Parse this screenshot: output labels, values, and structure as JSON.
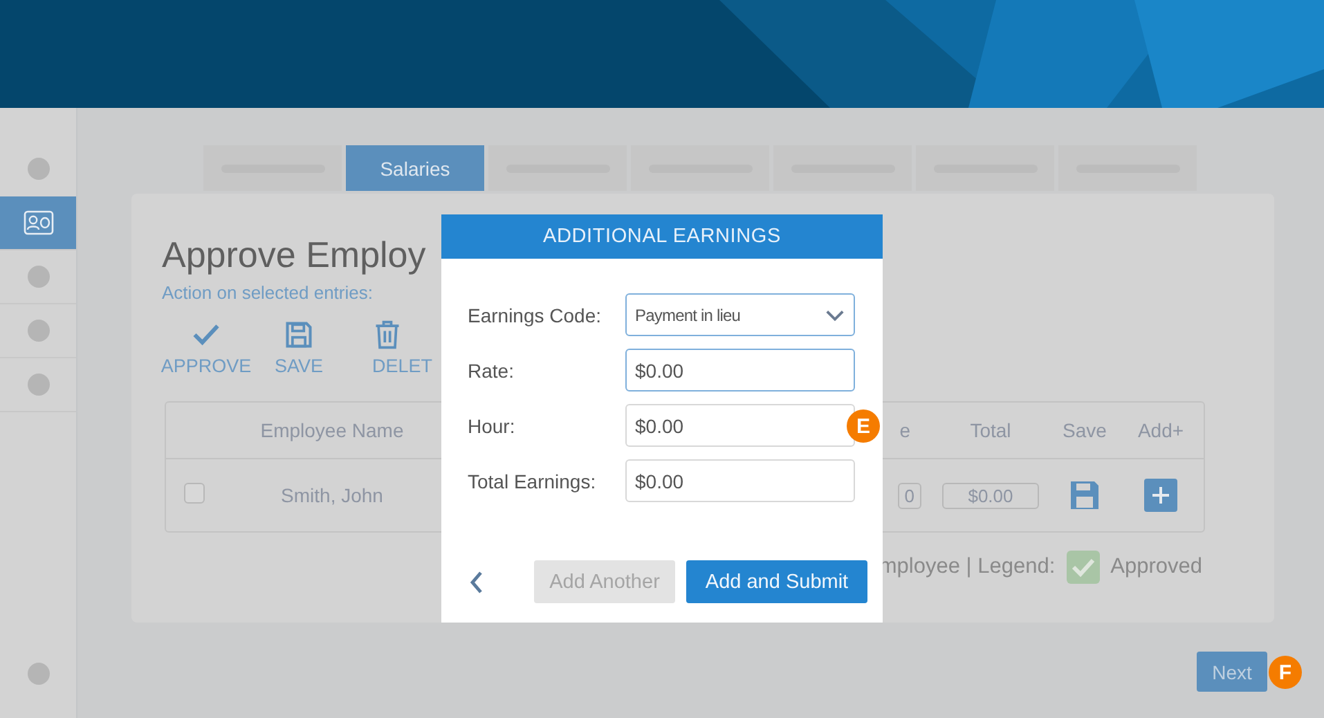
{
  "sidebar": {
    "items": [
      {
        "kind": "dot",
        "selected": false
      },
      {
        "kind": "icon",
        "selected": true
      },
      {
        "kind": "dot",
        "selected": false
      },
      {
        "kind": "dot",
        "selected": false
      },
      {
        "kind": "dot",
        "selected": false
      }
    ]
  },
  "tabs": [
    {
      "kind": "placeholder",
      "selected": false
    },
    {
      "kind": "text",
      "label": "Salaries",
      "selected": true
    },
    {
      "kind": "placeholder",
      "selected": false
    },
    {
      "kind": "placeholder",
      "selected": false
    },
    {
      "kind": "placeholder",
      "selected": false
    },
    {
      "kind": "placeholder",
      "selected": false
    },
    {
      "kind": "placeholder",
      "selected": false
    }
  ],
  "page": {
    "title": "Approve Employ",
    "subtitle": "Action on selected entries:",
    "actions": [
      {
        "kind": "check",
        "label": "APPROVE"
      },
      {
        "kind": "save",
        "label": "SAVE"
      },
      {
        "kind": "delete",
        "label": "DELET"
      }
    ]
  },
  "table": {
    "columns": [
      "Employee Name",
      "e",
      "Total",
      "Save",
      "Add+"
    ],
    "rows": [
      {
        "checked": false,
        "name": "Smith, John",
        "column_3": "0",
        "total": "$0.00"
      }
    ]
  },
  "legend": {
    "text": "mployee | Legend:",
    "label": "Approved"
  },
  "next_button": "Next",
  "dialog": {
    "title": "ADDITIONAL EARNINGS",
    "fields": [
      {
        "kind": "select",
        "label": "Earnings Code:",
        "value": "Payment in lieu",
        "focused": true
      },
      {
        "kind": "text",
        "label": "Rate:",
        "value": "$0.00",
        "focused": true
      },
      {
        "kind": "text",
        "label": "Hour:",
        "value": "$0.00",
        "focused": false,
        "marker": "E"
      },
      {
        "kind": "text",
        "label": "Total Earnings:",
        "value": "$0.00",
        "focused": false
      }
    ],
    "buttons": [
      {
        "label": "Add Another",
        "disabled": true
      },
      {
        "label": "Add and Submit",
        "disabled": false
      }
    ]
  },
  "next_marker": "F"
}
